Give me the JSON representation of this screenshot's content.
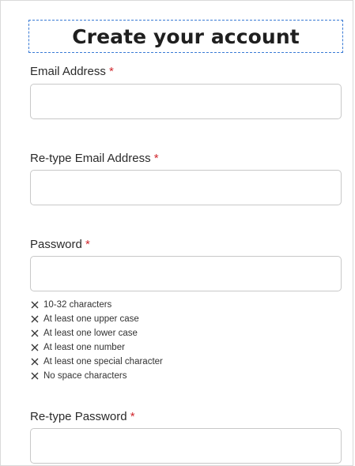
{
  "form": {
    "title": "Create your account",
    "required_mark": "*",
    "email": {
      "label": "Email Address",
      "value": "",
      "placeholder": ""
    },
    "email_confirm": {
      "label": "Re-type Email Address",
      "value": "",
      "placeholder": ""
    },
    "password": {
      "label": "Password",
      "value": "",
      "placeholder": "",
      "rules": [
        "10-32 characters",
        "At least one upper case",
        "At least one lower case",
        "At least one number",
        "At least one special character",
        "No space characters"
      ],
      "rule_icon": "close-icon"
    },
    "password_confirm": {
      "label": "Re-type Password",
      "value": "",
      "placeholder": ""
    }
  },
  "colors": {
    "required": "#d0272d",
    "title_outline": "#3a7bd5"
  }
}
